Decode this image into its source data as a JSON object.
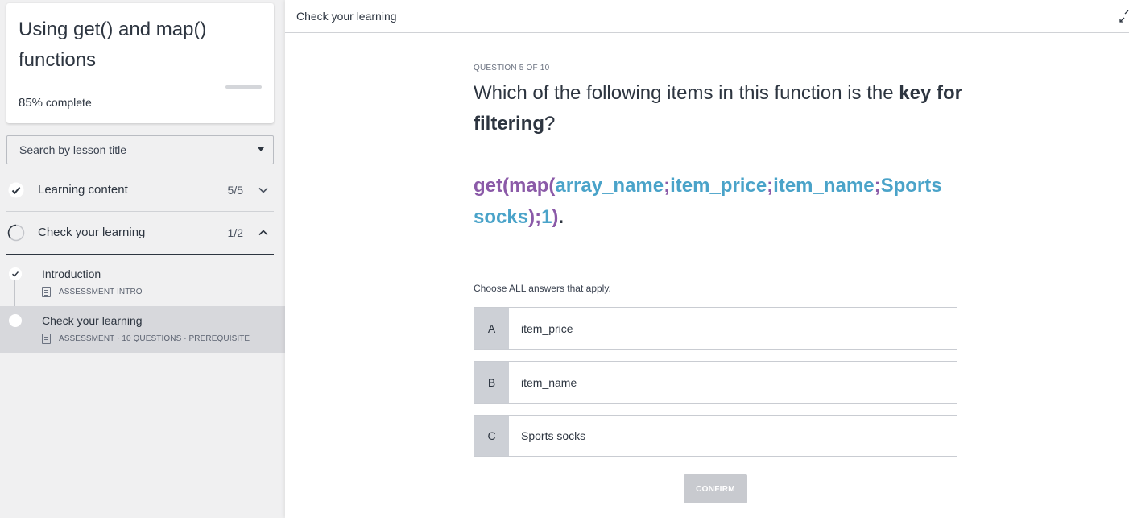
{
  "sidebar": {
    "course": {
      "title": "Using get() and map() functions",
      "progress_percent": "85%",
      "progress_suffix": "complete",
      "progress_fraction": 0.85
    },
    "search": {
      "placeholder": "Search by lesson title"
    },
    "sections": [
      {
        "label": "Learning content",
        "count": "5/5",
        "status": "complete",
        "expanded": false
      },
      {
        "label": "Check your learning",
        "count": "1/2",
        "status": "in-progress",
        "expanded": true
      }
    ],
    "lessons": [
      {
        "title": "Introduction",
        "meta": "ASSESSMENT INTRO",
        "status": "complete",
        "selected": false
      },
      {
        "title": "Check your learning",
        "meta": "ASSESSMENT · 10 QUESTIONS · PREREQUISITE",
        "status": "current",
        "selected": true
      }
    ]
  },
  "topbar": {
    "title": "Check your learning",
    "expand_icon": "expand-icon"
  },
  "question": {
    "label": "QUESTION 5 OF 10",
    "text_plain": "Which of the following items in this function is the ",
    "text_bold": "key for filtering",
    "text_end": "?",
    "formula": {
      "get": "get(",
      "map": "map(",
      "arg1": "array_name",
      "sep1": ";",
      "arg2": "item_price",
      "sep2": ";",
      "arg3": "item_name",
      "sep3": ";",
      "arg4": "Sports socks",
      "close1": ")",
      "sep4": ";",
      "arg5": "1",
      "close2": ")",
      "dot": "."
    },
    "instruction": "Choose ALL answers that apply.",
    "options": [
      {
        "letter": "A",
        "text": "item_price"
      },
      {
        "letter": "B",
        "text": "item_name"
      },
      {
        "letter": "C",
        "text": "Sports socks"
      }
    ],
    "confirm_label": "CONFIRM"
  },
  "colors": {
    "function_purple": "#8b5aa8",
    "argument_blue": "#4aa3c9",
    "text_dark": "#2d3540",
    "sidebar_bg": "#f0f0f1",
    "selected_lesson_bg": "#d7d8dc"
  }
}
